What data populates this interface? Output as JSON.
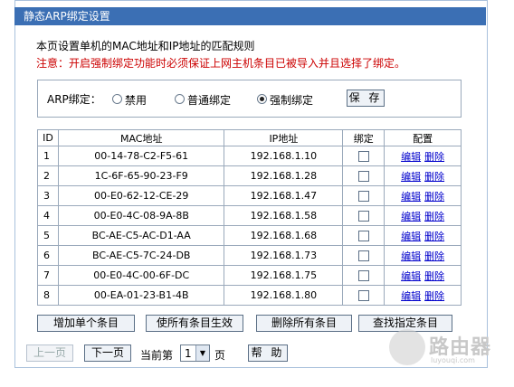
{
  "title": "静态ARP绑定设置",
  "description": "本页设置单机的MAC地址和IP地址的匹配规则",
  "warning": "注意：开启强制绑定功能时必须保证上网主机条目已被导入并且选择了绑定。",
  "arp_binding": {
    "label": "ARP绑定：",
    "options": [
      "禁用",
      "普通绑定",
      "强制绑定"
    ],
    "selected": "强制绑定",
    "save_label": "保 存"
  },
  "table": {
    "headers": [
      "ID",
      "MAC地址",
      "IP地址",
      "绑定",
      "配置"
    ],
    "edit_label": "编辑",
    "delete_label": "删除",
    "rows": [
      {
        "id": "1",
        "mac": "00-14-78-C2-F5-61",
        "ip": "192.168.1.10",
        "bound": false
      },
      {
        "id": "2",
        "mac": "1C-6F-65-90-23-F9",
        "ip": "192.168.1.28",
        "bound": false
      },
      {
        "id": "3",
        "mac": "00-E0-62-12-CE-29",
        "ip": "192.168.1.47",
        "bound": false
      },
      {
        "id": "4",
        "mac": "00-E0-4C-08-9A-8B",
        "ip": "192.168.1.58",
        "bound": false
      },
      {
        "id": "5",
        "mac": "BC-AE-C5-AC-D1-AA",
        "ip": "192.168.1.68",
        "bound": false
      },
      {
        "id": "6",
        "mac": "BC-AE-C5-7C-24-DB",
        "ip": "192.168.1.73",
        "bound": false
      },
      {
        "id": "7",
        "mac": "00-E0-4C-00-6F-DC",
        "ip": "192.168.1.75",
        "bound": false
      },
      {
        "id": "8",
        "mac": "00-EA-01-23-B1-4B",
        "ip": "192.168.1.80",
        "bound": false
      }
    ]
  },
  "actions": {
    "add_single": "增加单个条目",
    "enable_all": "使所有条目生效",
    "delete_all": "删除所有条目",
    "find": "查找指定条目"
  },
  "pager": {
    "prev": "上一页",
    "next": "下一页",
    "current_label": "当前第",
    "current_page": "1",
    "page_unit": "页",
    "help": "帮 助"
  },
  "watermark": {
    "text": "路由器",
    "sub": "luyouqi.com"
  },
  "colors": {
    "title_bar": "#3b6fb4",
    "warning": "#cc0000",
    "link": "#0000cc",
    "border": "#9aa9bb"
  }
}
